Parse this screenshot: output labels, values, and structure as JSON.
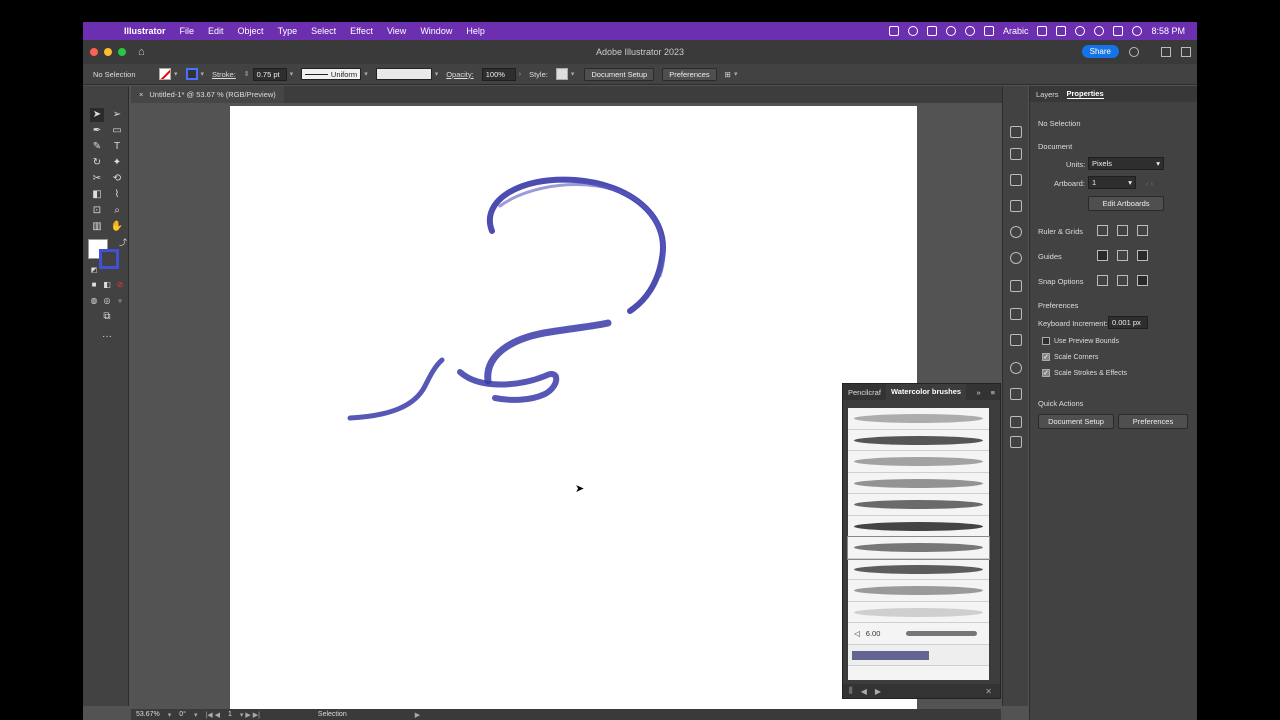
{
  "menubar": {
    "app_name": "Illustrator",
    "items": [
      "File",
      "Edit",
      "Object",
      "Type",
      "Select",
      "Effect",
      "View",
      "Window",
      "Help"
    ],
    "input_language": "Arabic",
    "clock": "8:58 PM"
  },
  "window": {
    "title": "Adobe Illustrator 2023",
    "share_label": "Share"
  },
  "control_bar": {
    "selection_label": "No Selection",
    "stroke_label": "Stroke:",
    "stroke_weight": "0.75 pt",
    "profile": "Uniform",
    "opacity_label": "Opacity:",
    "opacity_value": "100%",
    "style_label": "Style:",
    "document_setup": "Document Setup",
    "preferences": "Preferences"
  },
  "document_tab": {
    "title": "Untitled-1* @ 53.67 % (RGB/Preview)",
    "close": "×"
  },
  "properties": {
    "tabs": [
      "Layers",
      "Properties"
    ],
    "active_tab": "Properties",
    "no_selection": "No Selection",
    "document_heading": "Document",
    "units_label": "Units:",
    "units_value": "Pixels",
    "artboard_label": "Artboard:",
    "artboard_value": "1",
    "edit_artboards": "Edit Artboards",
    "ruler_grids": "Ruler & Grids",
    "guides": "Guides",
    "snap_options": "Snap Options",
    "preferences_heading": "Preferences",
    "keyboard_increment_label": "Keyboard Increment:",
    "keyboard_increment_value": "0.001 px",
    "use_preview_bounds": "Use Preview Bounds",
    "use_preview_bounds_checked": false,
    "scale_corners": "Scale Corners",
    "scale_corners_checked": true,
    "scale_strokes": "Scale Strokes & Effects",
    "scale_strokes_checked": true,
    "quick_actions": "Quick Actions",
    "qa_document_setup": "Document Setup",
    "qa_preferences": "Preferences"
  },
  "brush_panel": {
    "tabs": [
      "Pencilcraf",
      "Watercolor brushes"
    ],
    "active_tab": "Watercolor brushes",
    "brush_size": "6.00",
    "selected_index": 7,
    "brush_rows": 11
  },
  "status_bar": {
    "zoom": "53.67%",
    "rotation": "0°",
    "artboard_number": "1",
    "tool": "Selection"
  },
  "colors": {
    "menubar": "#6b2fb0",
    "accent": "#1473e6",
    "stroke_blue": "#3f3fb0"
  }
}
